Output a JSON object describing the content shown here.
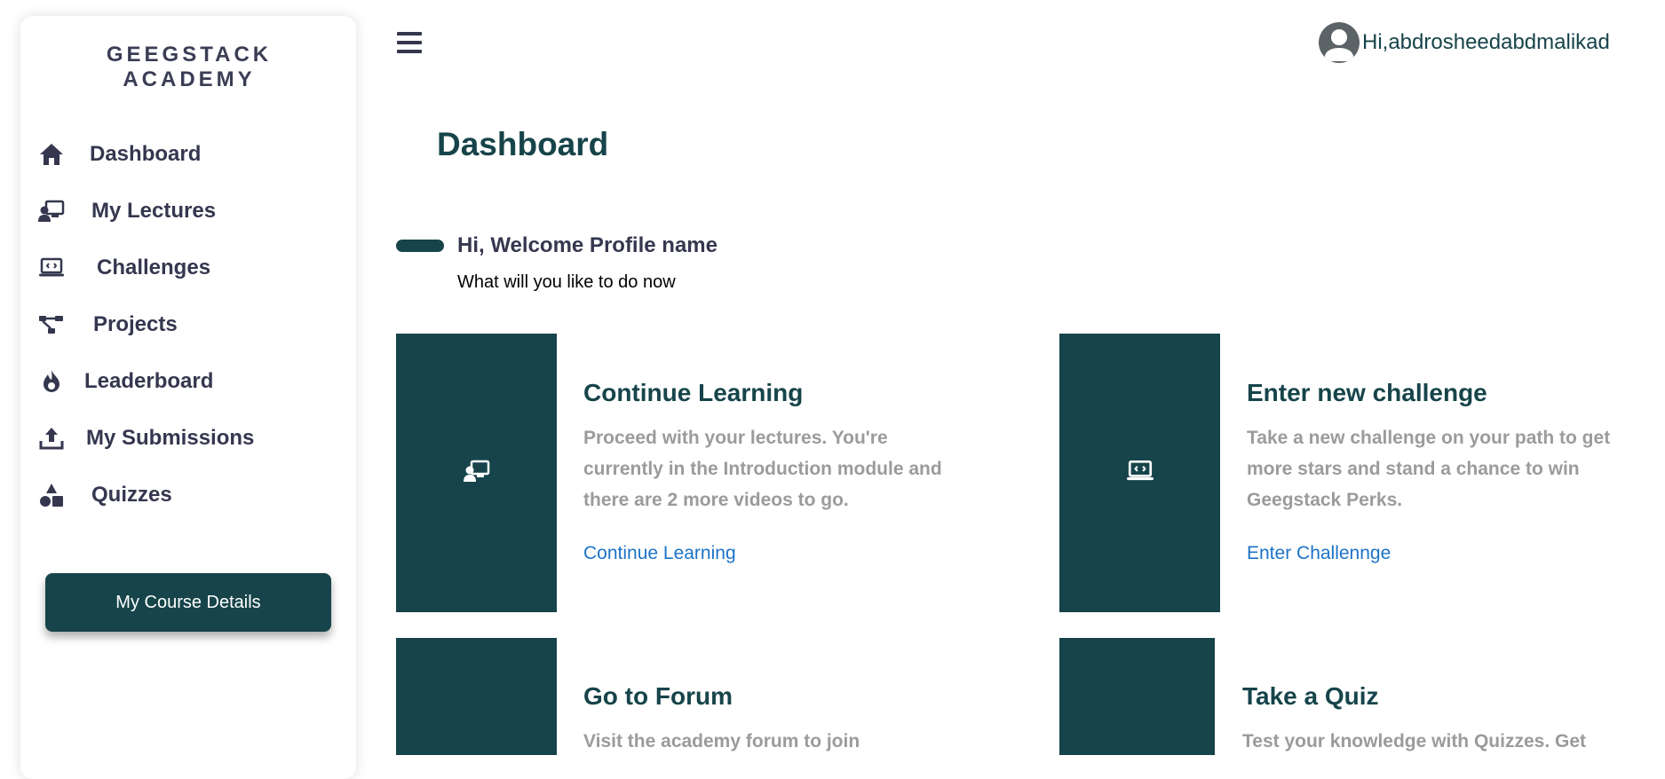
{
  "sidebar": {
    "brand": "GEEGSTACK ACADEMY",
    "items": [
      {
        "label": "Dashboard"
      },
      {
        "label": "My Lectures"
      },
      {
        "label": "Challenges"
      },
      {
        "label": "Projects"
      },
      {
        "label": "Leaderboard"
      },
      {
        "label": "My Submissions"
      },
      {
        "label": "Quizzes"
      }
    ],
    "course_button": "My Course Details"
  },
  "header": {
    "user_greeting": "Hi,abdrosheedabdmalikad"
  },
  "main": {
    "title": "Dashboard",
    "welcome": "Hi, Welcome Profile name",
    "subtitle": "What will you like to do now",
    "cards": [
      {
        "title": "Continue Learning",
        "description": "Proceed with your lectures. You're currently in the Introduction module and there are 2 more videos to go.",
        "link": "Continue Learning"
      },
      {
        "title": "Enter new challenge",
        "description": "Take a new challenge on your path to get more stars and stand a chance to win Geegstack Perks.",
        "link": "Enter Challennge"
      },
      {
        "title": "Go to Forum",
        "description": "Visit the academy forum to join"
      },
      {
        "title": "Take a Quiz",
        "description": "Test your knowledge with Quizzes. Get"
      }
    ]
  },
  "colors": {
    "primary": "#16444a",
    "text_dark": "#35374f",
    "muted": "#9b9b9b",
    "link": "#1c73c7"
  },
  "icons": {
    "nav": [
      "home-icon",
      "lecture-icon",
      "laptop-code-icon",
      "project-nodes-icon",
      "fire-icon",
      "upload-icon",
      "shapes-icon"
    ],
    "cards": [
      "lecture-icon",
      "laptop-code-icon"
    ],
    "header": [
      "menu-icon",
      "user-avatar-icon"
    ]
  }
}
